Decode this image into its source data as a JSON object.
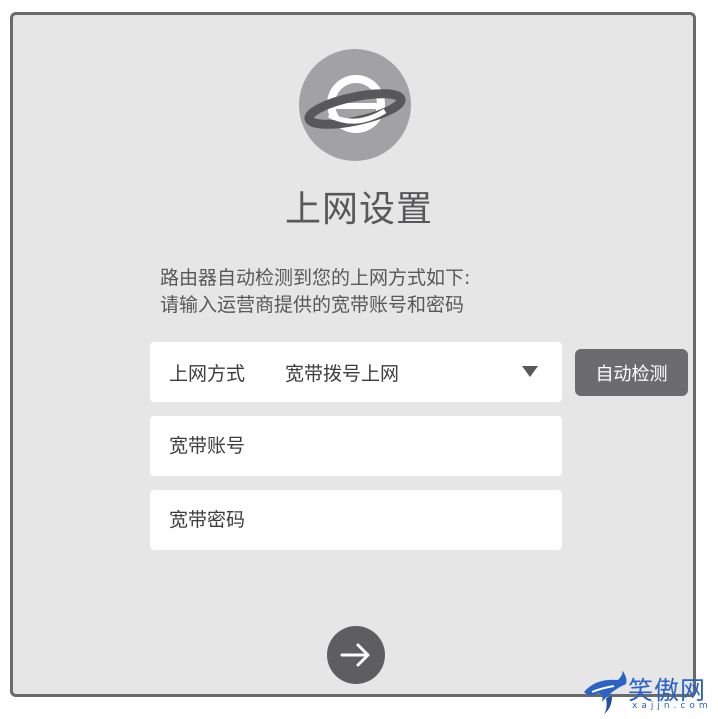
{
  "page": {
    "title": "上网设置",
    "description": [
      "路由器自动检测到您的上网方式如下:",
      "请输入运营商提供的宽带账号和密码"
    ]
  },
  "connection_type": {
    "label": "上网方式",
    "selected_value": "宽带拨号上网"
  },
  "detect_button": {
    "label": "自动检测"
  },
  "account_field": {
    "placeholder": "宽带账号",
    "value": ""
  },
  "password_field": {
    "placeholder": "宽带密码",
    "value": ""
  },
  "next_button": {
    "icon": "arrow-right-icon"
  },
  "icons": {
    "logo": "planet-icon",
    "dropdown": "caret-down-icon"
  },
  "watermark": {
    "text": "笑傲网",
    "sub": "xajjn.com"
  },
  "colors": {
    "panel_bg": "#e6e6e7",
    "panel_border": "#6a6a6c",
    "text": "#58585a",
    "button": "#6c6c6e",
    "watermark": "#2a63c5"
  }
}
